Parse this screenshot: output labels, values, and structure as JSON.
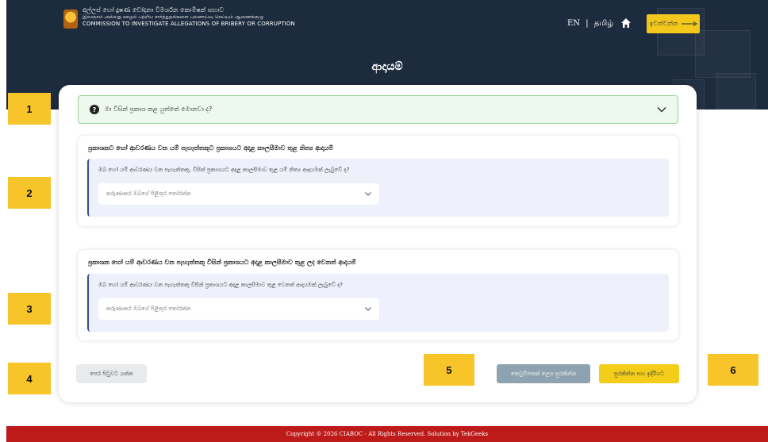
{
  "header": {
    "org_name_si": "අල්ලස් හෝ දූෂණ චෝදනා විමර්ශන කොමිෂන් සභාව",
    "org_name_ta": "இலஞ்சம் அல்லது ஊழல் பற்றிய சார்த்துதல்களை புலனாய்வு செய்யும் ஆணைக்குழு",
    "org_name_en": "COMMISSION TO INVESTIGATE ALLEGATIONS OF BRIBERY OR CORRUPTION",
    "lang_en": "EN",
    "lang_separator": "|",
    "lang_ta": "தமிழ்",
    "home_icon": "home-icon",
    "login_label": "ඉවත්වන්න",
    "login_icon": "arrow-right-icon",
    "page_title": "ආදායම්",
    "background_color": "#1c2b3e"
  },
  "faq": {
    "question": "මා විසින් ප්‍රකාශ කළ යුත්තේ මොනවා ද?",
    "icon": "question-circle-icon",
    "toggle_icon": "chevron-down-icon"
  },
  "sections": [
    {
      "title": "ප්‍රකාශකට හෝ ආවරණය වන යම් පැහැත්තකුට ප්‍රකාශයට අදාළ කාලසීමාව තුළ නිත්‍ය ආදායම්",
      "question": "ඔබ හෝ යම් ආවරණය වන පැහැත්තකු, විසින් ප්‍රකාශයට අදාළ කාලසීමාව තුළ යම් නිත්‍ය ආදායමක් ලැබුවේ ද?",
      "select_placeholder": "කරුණාකර ඔබගේ පිළිතුර තෝරන්න"
    },
    {
      "title": "ප්‍රකාශක හෝ යම් ආවරණය වන පැහැත්තකු විසින් ප්‍රකාශයට අදාළ කාලසීමාව තුළ ලද වෙනත් ආදායම්",
      "question": "ඔබ හෝ යම් ආවරණය වන පැහැත්තකු විසින් ප්‍රකාශයට අදාළ කාලසීමාව තුළ වෙනත් ආදායමක් ලැබුවේ ද?",
      "select_placeholder": "කරුණාකර ඔබගේ පිළිතුර තෝරන්න"
    }
  ],
  "buttons": {
    "back": "පෙර පිටුවට යන්න",
    "save_draft": "කෙටුම්පතක් ලෙස සුරකින්න",
    "save_continue": "සුරකින්න සහ ඉදිරියට",
    "draft_color": "#8ea3af",
    "primary_color": "#f4cd1a"
  },
  "markers": [
    "1",
    "2",
    "3",
    "4",
    "5",
    "6"
  ],
  "marker_color": "#f7c42a",
  "footer": {
    "text": "Copyright © 2026 CIABOC - All Rights Reserved. Solution by TekGeeks",
    "color": "#bd1a1a"
  }
}
